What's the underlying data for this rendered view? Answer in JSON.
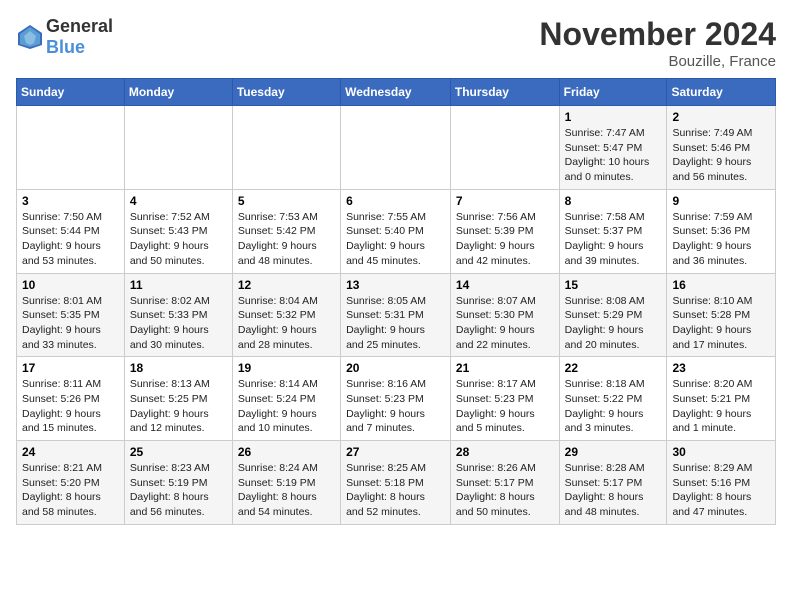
{
  "logo": {
    "text_general": "General",
    "text_blue": "Blue"
  },
  "title": "November 2024",
  "location": "Bouzille, France",
  "weekdays": [
    "Sunday",
    "Monday",
    "Tuesday",
    "Wednesday",
    "Thursday",
    "Friday",
    "Saturday"
  ],
  "weeks": [
    [
      {
        "day": "",
        "content": ""
      },
      {
        "day": "",
        "content": ""
      },
      {
        "day": "",
        "content": ""
      },
      {
        "day": "",
        "content": ""
      },
      {
        "day": "",
        "content": ""
      },
      {
        "day": "1",
        "content": "Sunrise: 7:47 AM\nSunset: 5:47 PM\nDaylight: 10 hours and 0 minutes."
      },
      {
        "day": "2",
        "content": "Sunrise: 7:49 AM\nSunset: 5:46 PM\nDaylight: 9 hours and 56 minutes."
      }
    ],
    [
      {
        "day": "3",
        "content": "Sunrise: 7:50 AM\nSunset: 5:44 PM\nDaylight: 9 hours and 53 minutes."
      },
      {
        "day": "4",
        "content": "Sunrise: 7:52 AM\nSunset: 5:43 PM\nDaylight: 9 hours and 50 minutes."
      },
      {
        "day": "5",
        "content": "Sunrise: 7:53 AM\nSunset: 5:42 PM\nDaylight: 9 hours and 48 minutes."
      },
      {
        "day": "6",
        "content": "Sunrise: 7:55 AM\nSunset: 5:40 PM\nDaylight: 9 hours and 45 minutes."
      },
      {
        "day": "7",
        "content": "Sunrise: 7:56 AM\nSunset: 5:39 PM\nDaylight: 9 hours and 42 minutes."
      },
      {
        "day": "8",
        "content": "Sunrise: 7:58 AM\nSunset: 5:37 PM\nDaylight: 9 hours and 39 minutes."
      },
      {
        "day": "9",
        "content": "Sunrise: 7:59 AM\nSunset: 5:36 PM\nDaylight: 9 hours and 36 minutes."
      }
    ],
    [
      {
        "day": "10",
        "content": "Sunrise: 8:01 AM\nSunset: 5:35 PM\nDaylight: 9 hours and 33 minutes."
      },
      {
        "day": "11",
        "content": "Sunrise: 8:02 AM\nSunset: 5:33 PM\nDaylight: 9 hours and 30 minutes."
      },
      {
        "day": "12",
        "content": "Sunrise: 8:04 AM\nSunset: 5:32 PM\nDaylight: 9 hours and 28 minutes."
      },
      {
        "day": "13",
        "content": "Sunrise: 8:05 AM\nSunset: 5:31 PM\nDaylight: 9 hours and 25 minutes."
      },
      {
        "day": "14",
        "content": "Sunrise: 8:07 AM\nSunset: 5:30 PM\nDaylight: 9 hours and 22 minutes."
      },
      {
        "day": "15",
        "content": "Sunrise: 8:08 AM\nSunset: 5:29 PM\nDaylight: 9 hours and 20 minutes."
      },
      {
        "day": "16",
        "content": "Sunrise: 8:10 AM\nSunset: 5:28 PM\nDaylight: 9 hours and 17 minutes."
      }
    ],
    [
      {
        "day": "17",
        "content": "Sunrise: 8:11 AM\nSunset: 5:26 PM\nDaylight: 9 hours and 15 minutes."
      },
      {
        "day": "18",
        "content": "Sunrise: 8:13 AM\nSunset: 5:25 PM\nDaylight: 9 hours and 12 minutes."
      },
      {
        "day": "19",
        "content": "Sunrise: 8:14 AM\nSunset: 5:24 PM\nDaylight: 9 hours and 10 minutes."
      },
      {
        "day": "20",
        "content": "Sunrise: 8:16 AM\nSunset: 5:23 PM\nDaylight: 9 hours and 7 minutes."
      },
      {
        "day": "21",
        "content": "Sunrise: 8:17 AM\nSunset: 5:23 PM\nDaylight: 9 hours and 5 minutes."
      },
      {
        "day": "22",
        "content": "Sunrise: 8:18 AM\nSunset: 5:22 PM\nDaylight: 9 hours and 3 minutes."
      },
      {
        "day": "23",
        "content": "Sunrise: 8:20 AM\nSunset: 5:21 PM\nDaylight: 9 hours and 1 minute."
      }
    ],
    [
      {
        "day": "24",
        "content": "Sunrise: 8:21 AM\nSunset: 5:20 PM\nDaylight: 8 hours and 58 minutes."
      },
      {
        "day": "25",
        "content": "Sunrise: 8:23 AM\nSunset: 5:19 PM\nDaylight: 8 hours and 56 minutes."
      },
      {
        "day": "26",
        "content": "Sunrise: 8:24 AM\nSunset: 5:19 PM\nDaylight: 8 hours and 54 minutes."
      },
      {
        "day": "27",
        "content": "Sunrise: 8:25 AM\nSunset: 5:18 PM\nDaylight: 8 hours and 52 minutes."
      },
      {
        "day": "28",
        "content": "Sunrise: 8:26 AM\nSunset: 5:17 PM\nDaylight: 8 hours and 50 minutes."
      },
      {
        "day": "29",
        "content": "Sunrise: 8:28 AM\nSunset: 5:17 PM\nDaylight: 8 hours and 48 minutes."
      },
      {
        "day": "30",
        "content": "Sunrise: 8:29 AM\nSunset: 5:16 PM\nDaylight: 8 hours and 47 minutes."
      }
    ]
  ]
}
